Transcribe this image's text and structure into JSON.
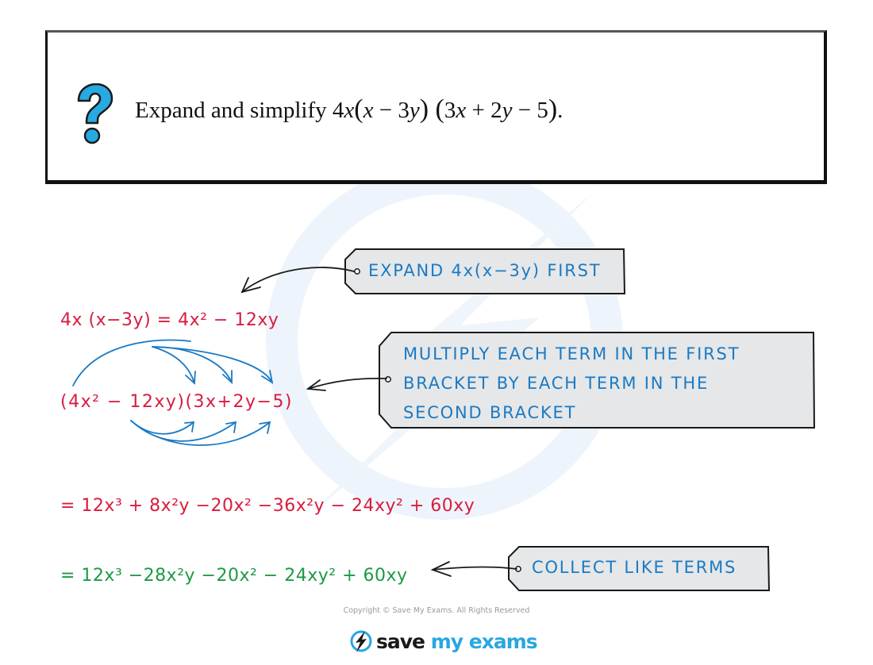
{
  "question": {
    "icon": "question-mark-icon",
    "prompt": "Expand and simplify",
    "expression_parts": [
      "4",
      "x",
      "(",
      "x",
      " − 3",
      "y",
      ")",
      " (",
      "3",
      "x",
      " + 2",
      "y",
      " − 5",
      ")",
      "."
    ]
  },
  "steps": {
    "step1": "4x (x−3y) = 4x² − 12xy",
    "step2": "(4x² − 12xy)(3x+2y−5)",
    "step3": "= 12x³ + 8x²y −20x² −36x²y − 24xy² + 60xy",
    "step4": "= 12x³ −28x²y −20x² − 24xy² + 60xy"
  },
  "annotations": {
    "expand_first": "EXPAND  4x(x−3y)  FIRST",
    "multiply_lines": [
      "MULTIPLY  EACH  TERM  IN  THE  FIRST",
      "BRACKET  BY  EACH  TERM  IN  THE",
      "SECOND  BRACKET"
    ],
    "collect": "COLLECT  LIKE  TERMS"
  },
  "colors": {
    "working": "#d81c3f",
    "final_answer": "#1b9a44",
    "annotation_text": "#1a7ac4",
    "tag_fill": "#e6e7e8",
    "brand": "#2aa6e0"
  },
  "footer": {
    "copyright": "Copyright © Save My Exams. All Rights Reserved",
    "logo_dark": "save",
    "logo_brand": "my exams"
  }
}
